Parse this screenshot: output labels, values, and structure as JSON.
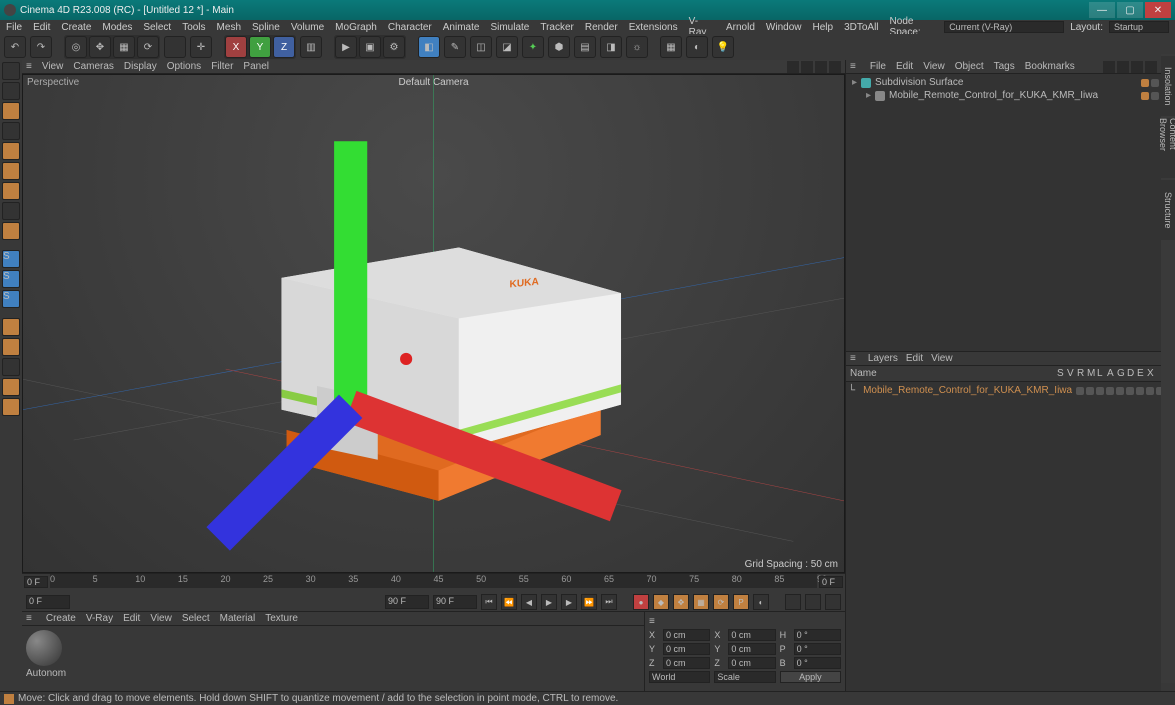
{
  "title": "Cinema 4D R23.008 (RC) - [Untitled 12 *] - Main",
  "menu": [
    "File",
    "Edit",
    "Create",
    "Modes",
    "Select",
    "Tools",
    "Mesh",
    "Spline",
    "Volume",
    "MoGraph",
    "Character",
    "Animate",
    "Simulate",
    "Tracker",
    "Render",
    "Extensions",
    "V-Ray",
    "Arnold",
    "Window",
    "Help",
    "3DToAll"
  ],
  "nodeSpaceLabel": "Node Space:",
  "nodeSpaceValue": "Current (V-Ray)",
  "layoutLabel": "Layout:",
  "layoutValue": "Startup",
  "viewportMenu": [
    "View",
    "Cameras",
    "Display",
    "Options",
    "Filter",
    "Panel"
  ],
  "vpLabel": "Perspective",
  "camLabel": "Default Camera",
  "gridLabel": "Grid Spacing : 50 cm",
  "timeline": {
    "start": 0,
    "end": 90,
    "frameLeft": "0 F",
    "frameRight": "0 F",
    "rangeStart": "0 F",
    "rangeEnd": "90 F",
    "current": "90 F"
  },
  "objMenu": [
    "File",
    "Edit",
    "View",
    "Object",
    "Tags",
    "Bookmarks"
  ],
  "tree": [
    {
      "name": "Subdivision Surface",
      "indent": 0,
      "iconColor": "#4aa"
    },
    {
      "name": "Mobile_Remote_Control_for_KUKA_KMR_Iiwa",
      "indent": 1,
      "iconColor": "#888"
    }
  ],
  "layerMenu": [
    "Layers",
    "Edit",
    "View"
  ],
  "layerColsName": "Name",
  "layerCols": [
    "S",
    "V",
    "R",
    "M",
    "L",
    "A",
    "G",
    "D",
    "E",
    "X"
  ],
  "layers": [
    {
      "name": "Mobile_Remote_Control_for_KUKA_KMR_Iiwa"
    }
  ],
  "matMenu": [
    "Create",
    "V-Ray",
    "Edit",
    "View",
    "Select",
    "Material",
    "Texture"
  ],
  "matName": "Autonom",
  "coords": {
    "rows": [
      {
        "axis": "X",
        "pos": "0 cm",
        "sizeLabel": "X",
        "size": "0 cm",
        "rotLabel": "H",
        "rot": "0 °"
      },
      {
        "axis": "Y",
        "pos": "0 cm",
        "sizeLabel": "Y",
        "size": "0 cm",
        "rotLabel": "P",
        "rot": "0 °"
      },
      {
        "axis": "Z",
        "pos": "0 cm",
        "sizeLabel": "Z",
        "size": "0 cm",
        "rotLabel": "B",
        "rot": "0 °"
      }
    ],
    "world": "World",
    "scale": "Scale",
    "apply": "Apply"
  },
  "status": "Move: Click and drag to move elements. Hold down SHIFT to quantize movement / add to the selection in point mode, CTRL to remove.",
  "rightTabs": [
    "Insolation",
    "Content Browser",
    "Structure"
  ]
}
